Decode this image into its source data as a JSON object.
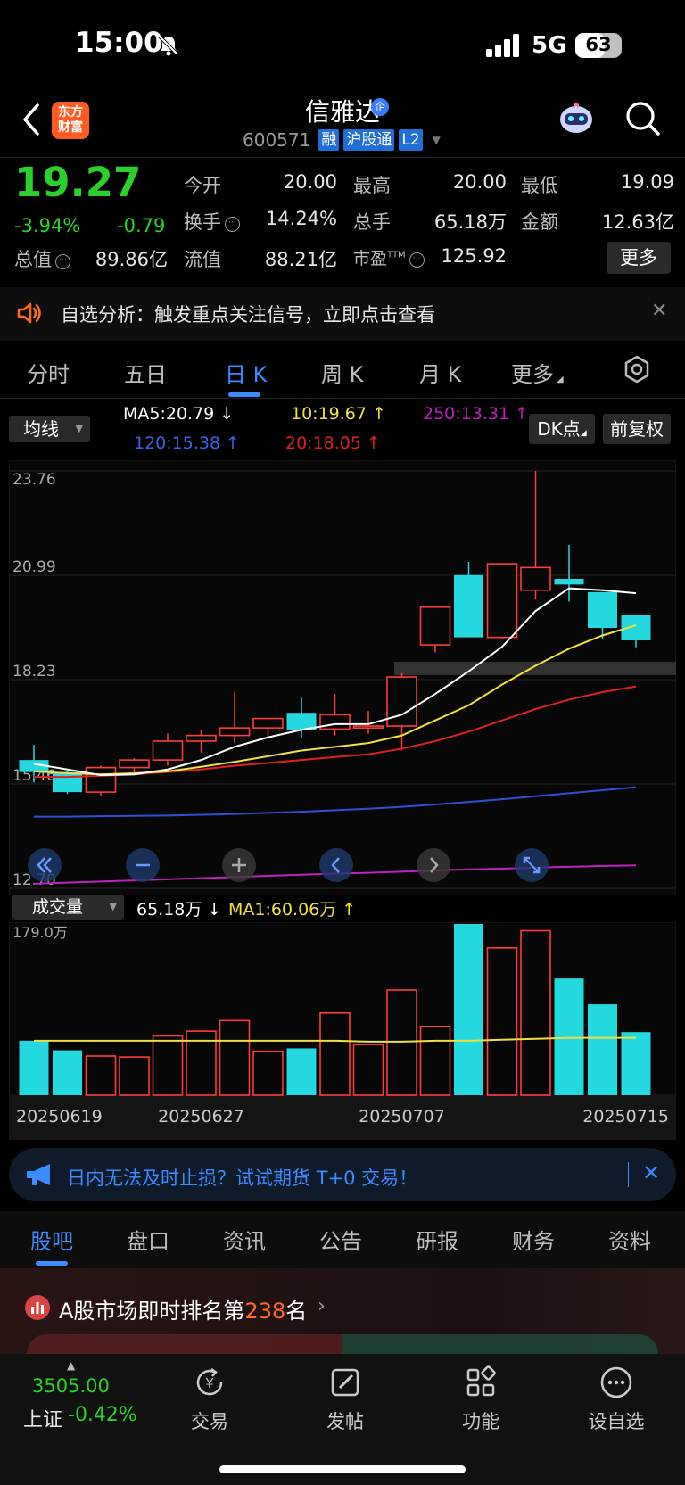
{
  "status": {
    "time": "15:00",
    "network": "5G",
    "battery": "63",
    "battery_level_pct": 63
  },
  "header": {
    "logo_line1": "东方",
    "logo_line2": "财富",
    "stock_name": "信雅达",
    "badge": "企",
    "code": "600571",
    "tags": [
      "融",
      "沪股通",
      "L2"
    ]
  },
  "quote": {
    "price": "19.27",
    "change_pct": "-3.94%",
    "change": "-0.79",
    "open_label": "今开",
    "open": "20.00",
    "high_label": "最高",
    "high": "20.00",
    "low_label": "最低",
    "low": "19.09",
    "turnover_label": "换手",
    "turnover": "14.24%",
    "volume_label": "总手",
    "volume": "65.18万",
    "amount_label": "金额",
    "amount": "12.63亿",
    "total_mv_label": "总值",
    "total_mv": "89.86亿",
    "float_mv_label": "流值",
    "float_mv": "88.21亿",
    "pe_label": "市盈",
    "pe_sup": "TTM",
    "pe": "125.92",
    "more": "更多"
  },
  "notice": {
    "text": "自选分析：触发重点关注信号，立即点击查看"
  },
  "chart_tabs": [
    {
      "label": "分时"
    },
    {
      "label": "五日"
    },
    {
      "label": "日 K",
      "active": true
    },
    {
      "label": "周 K"
    },
    {
      "label": "月 K"
    },
    {
      "label": "更多"
    }
  ],
  "ma_row": {
    "select": "均线",
    "ma5": "MA5:20.79 ↓",
    "ma10": "10:19.67 ↑",
    "ma250": "250:13.31 ↑",
    "ma120": "120:15.38 ↑",
    "ma20": "20:18.05 ↑",
    "dk_button": "DK点",
    "fq_button": "前复权"
  },
  "colors": {
    "up": "#ff3b3b",
    "down": "#24d8e0",
    "ma5": "#ffffff",
    "ma10": "#f0e040",
    "ma20": "#e02020",
    "ma120": "#3050d8",
    "ma250": "#c020c0",
    "accent": "#3c8cff"
  },
  "chart_data": {
    "type": "candlestick",
    "price_axis_labels": [
      "23.76",
      "20.99",
      "18.23",
      "15.46",
      "12.70"
    ],
    "ylim": [
      12.7,
      23.76
    ],
    "candles": [
      {
        "o": 16.1,
        "h": 16.5,
        "l": 15.5,
        "c": 15.78
      },
      {
        "o": 15.78,
        "h": 15.8,
        "l": 15.2,
        "c": 15.25
      },
      {
        "o": 15.25,
        "h": 15.95,
        "l": 15.15,
        "c": 15.9
      },
      {
        "o": 15.9,
        "h": 16.15,
        "l": 15.75,
        "c": 16.1
      },
      {
        "o": 16.1,
        "h": 16.8,
        "l": 15.95,
        "c": 16.6
      },
      {
        "o": 16.6,
        "h": 16.9,
        "l": 16.3,
        "c": 16.75
      },
      {
        "o": 16.75,
        "h": 17.9,
        "l": 16.55,
        "c": 16.95
      },
      {
        "o": 16.95,
        "h": 17.15,
        "l": 16.7,
        "c": 17.2
      },
      {
        "o": 17.35,
        "h": 17.75,
        "l": 16.7,
        "c": 16.9
      },
      {
        "o": 16.92,
        "h": 17.85,
        "l": 16.75,
        "c": 17.3
      },
      {
        "o": 16.95,
        "h": 17.4,
        "l": 16.8,
        "c": 17.0
      },
      {
        "o": 17.0,
        "h": 18.4,
        "l": 16.35,
        "c": 18.3
      },
      {
        "o": 19.15,
        "h": 19.15,
        "l": 18.95,
        "c": 20.15
      },
      {
        "o": 21.0,
        "h": 21.35,
        "l": 19.35,
        "c": 19.35
      },
      {
        "o": 19.35,
        "h": 21.3,
        "l": 19.3,
        "c": 21.3
      },
      {
        "o": 20.6,
        "h": 23.76,
        "l": 20.35,
        "c": 21.2
      },
      {
        "o": 20.9,
        "h": 21.8,
        "l": 20.3,
        "c": 20.75
      },
      {
        "o": 20.55,
        "h": 20.55,
        "l": 19.3,
        "c": 19.6
      },
      {
        "o": 19.95,
        "h": 19.95,
        "l": 19.09,
        "c": 19.27
      }
    ],
    "ma5": [
      16.0,
      15.85,
      15.7,
      15.72,
      15.85,
      16.1,
      16.45,
      16.7,
      16.9,
      17.05,
      17.05,
      17.3,
      17.85,
      18.45,
      19.1,
      20.05,
      20.65,
      20.6,
      20.52
    ],
    "ma10": [
      15.8,
      15.75,
      15.72,
      15.75,
      15.8,
      15.92,
      16.05,
      16.2,
      16.35,
      16.45,
      16.55,
      16.75,
      17.15,
      17.55,
      18.1,
      18.6,
      19.05,
      19.4,
      19.67
    ],
    "ma20": [
      15.65,
      15.65,
      15.68,
      15.72,
      15.78,
      15.85,
      15.95,
      16.02,
      16.1,
      16.18,
      16.25,
      16.4,
      16.6,
      16.85,
      17.15,
      17.45,
      17.7,
      17.9,
      18.05
    ],
    "ma120": [
      14.6,
      14.6,
      14.61,
      14.62,
      14.63,
      14.65,
      14.67,
      14.7,
      14.73,
      14.77,
      14.81,
      14.86,
      14.92,
      14.99,
      15.06,
      15.14,
      15.22,
      15.3,
      15.38
    ],
    "ma250": [
      12.82,
      12.85,
      12.88,
      12.91,
      12.94,
      12.97,
      13.0,
      13.03,
      13.06,
      13.09,
      13.11,
      13.14,
      13.17,
      13.2,
      13.22,
      13.25,
      13.27,
      13.29,
      13.31
    ],
    "support_band": [
      18.35,
      18.7
    ],
    "volume_select": "成交量",
    "volume_now": "65.18万 ↓",
    "volume_ma": "MA1:60.06万 ↑",
    "volume_axis_max": "179.0万",
    "volume_max": 179.0,
    "volumes": [
      57,
      47,
      41,
      40,
      62,
      67,
      78,
      46,
      49,
      86,
      53,
      110,
      72,
      179,
      154,
      172,
      122,
      95,
      66
    ],
    "volume_ma1": [
      57,
      57,
      57,
      57,
      57,
      57,
      57,
      57,
      57,
      57,
      56,
      56,
      57,
      57,
      58,
      59,
      60,
      60,
      60
    ],
    "dates": [
      "20250619",
      "20250627",
      "20250707",
      "20250715"
    ]
  },
  "banner": {
    "text": "日内无法及时止损？试试期货 T+0 交易！"
  },
  "section_tabs": [
    {
      "label": "股吧",
      "active": true
    },
    {
      "label": "盘口"
    },
    {
      "label": "资讯"
    },
    {
      "label": "公告"
    },
    {
      "label": "研报"
    },
    {
      "label": "财务"
    },
    {
      "label": "资料"
    }
  ],
  "rank": {
    "prefix": "A股市场即时排名第",
    "num": "238",
    "suffix": "名"
  },
  "bottom_nav": {
    "index_value": "3505.00",
    "index_name": "上证",
    "index_pct": "-0.42%",
    "items": [
      {
        "label": "交易",
        "icon": "yuan-icon"
      },
      {
        "label": "发帖",
        "icon": "edit-icon"
      },
      {
        "label": "功能",
        "icon": "grid-icon"
      },
      {
        "label": "设自选",
        "icon": "more-icon"
      }
    ]
  }
}
